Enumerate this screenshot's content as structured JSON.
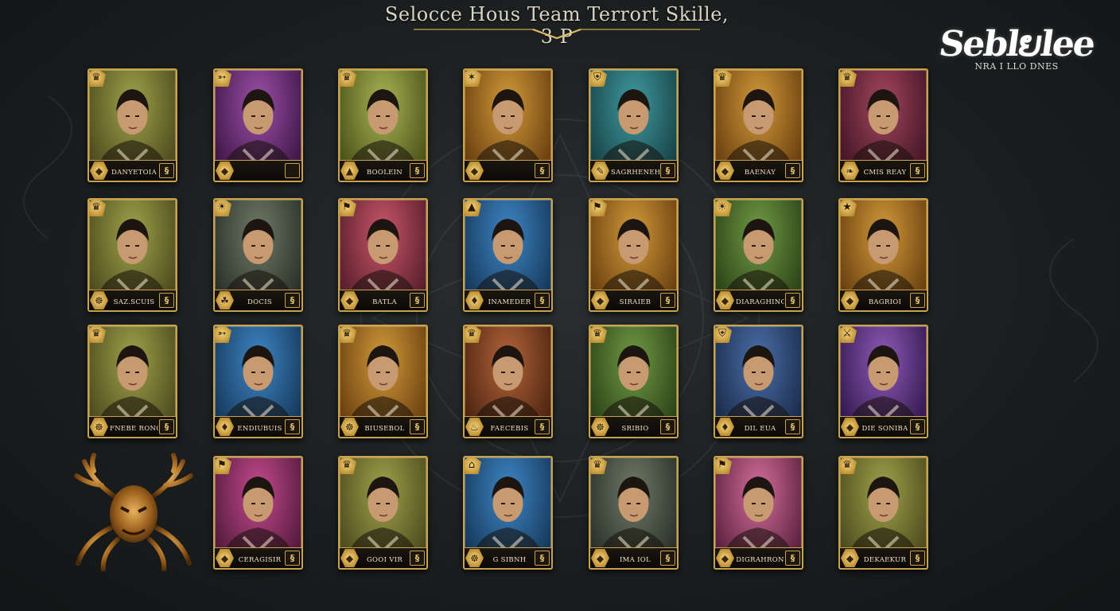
{
  "title": "Selocce Hous Team Terrort Skille, 3 P",
  "logo": {
    "mark": "Seblຍlee",
    "subtitle": "NRA I LLO DNES"
  },
  "colors": {
    "background": "#1c1f20",
    "gold": "#c8a24c",
    "text": "#efe3c2"
  },
  "emblem": {
    "icon": "antlered-demon-mask-icon"
  },
  "cards": [
    {
      "name": "DANYETOIA",
      "theme": "olive",
      "corner_icon": "crown-icon",
      "class_icon": "helm-icon",
      "skill_label": "§"
    },
    {
      "name": "",
      "theme": "purple",
      "corner_icon": "bow-icon",
      "class_icon": "helm-icon",
      "skill_label": ""
    },
    {
      "name": "BOOLEIN",
      "theme": "lime",
      "corner_icon": "crown-icon",
      "class_icon": "bell-icon",
      "skill_label": "§"
    },
    {
      "name": "",
      "theme": "amber",
      "corner_icon": "lantern-icon",
      "class_icon": "helm-icon",
      "skill_label": "§"
    },
    {
      "name": "SAGRHENEH",
      "theme": "teal",
      "corner_icon": "shield-icon",
      "class_icon": "quill-icon",
      "skill_label": "§"
    },
    {
      "name": "BAENAY",
      "theme": "amber",
      "corner_icon": "crown-icon",
      "class_icon": "helm-icon",
      "skill_label": "§"
    },
    {
      "name": "CMIS REAY",
      "theme": "maroon",
      "corner_icon": "crown-icon",
      "class_icon": "scroll-icon",
      "skill_label": "§"
    },
    {
      "name": "SAZ.SCUIS",
      "theme": "olive",
      "corner_icon": "crown-icon",
      "class_icon": "rune-icon",
      "skill_label": "§"
    },
    {
      "name": "DOCIS",
      "theme": "slate",
      "corner_icon": "sun-icon",
      "class_icon": "leaf-icon",
      "skill_label": "§"
    },
    {
      "name": "BATLA",
      "theme": "rose",
      "corner_icon": "flag-icon",
      "class_icon": "helm-icon",
      "skill_label": "§"
    },
    {
      "name": "INAMEDER",
      "theme": "blue",
      "corner_icon": "bell-icon",
      "class_icon": "gem-icon",
      "skill_label": "§"
    },
    {
      "name": "SIRAIEB",
      "theme": "amber",
      "corner_icon": "flag-icon",
      "class_icon": "helm-icon",
      "skill_label": "§"
    },
    {
      "name": "DIARAGHING",
      "theme": "green",
      "corner_icon": "sun-icon",
      "class_icon": "helm-icon",
      "skill_label": "§"
    },
    {
      "name": "BAGRIOI",
      "theme": "amber",
      "corner_icon": "star-icon",
      "class_icon": "helm-icon",
      "skill_label": "§"
    },
    {
      "name": "FNEBE RONO",
      "theme": "olive",
      "corner_icon": "crown-icon",
      "class_icon": "rune-icon",
      "skill_label": "§"
    },
    {
      "name": "ENDIUBUIS",
      "theme": "blue",
      "corner_icon": "bow-icon",
      "class_icon": "gem-icon",
      "skill_label": "§"
    },
    {
      "name": "BIUSEBOL",
      "theme": "amber",
      "corner_icon": "crown-icon",
      "class_icon": "rune-icon",
      "skill_label": "§"
    },
    {
      "name": "FAECEBIS",
      "theme": "rust",
      "corner_icon": "crown-icon",
      "class_icon": "flame-icon",
      "skill_label": "§"
    },
    {
      "name": "SRIBIO",
      "theme": "green",
      "corner_icon": "crown-icon",
      "class_icon": "rune-icon",
      "skill_label": "§"
    },
    {
      "name": "DIL EUA",
      "theme": "navy",
      "corner_icon": "shield-icon",
      "class_icon": "gem-icon",
      "skill_label": "§"
    },
    {
      "name": "DIE SONIBA",
      "theme": "violet",
      "corner_icon": "sword-icon",
      "class_icon": "helm-icon",
      "skill_label": "§"
    },
    {
      "name": "CERAGISIR",
      "theme": "magenta",
      "corner_icon": "flag-icon",
      "class_icon": "helm-icon",
      "skill_label": "§"
    },
    {
      "name": "GOOI VIR",
      "theme": "olive",
      "corner_icon": "crown-icon",
      "class_icon": "helm-icon",
      "skill_label": "§"
    },
    {
      "name": "G SIBNH",
      "theme": "blue",
      "corner_icon": "house-icon",
      "class_icon": "rune-icon",
      "skill_label": "§"
    },
    {
      "name": "IMA IOL",
      "theme": "slate",
      "corner_icon": "crown-icon",
      "class_icon": "helm-icon",
      "skill_label": "§"
    },
    {
      "name": "DIGRAHRON",
      "theme": "pink",
      "corner_icon": "flag-icon",
      "class_icon": "helm-icon",
      "skill_label": "§"
    },
    {
      "name": "DEKAEKUR",
      "theme": "olive",
      "corner_icon": "crown-icon",
      "class_icon": "helm-icon",
      "skill_label": "§"
    }
  ]
}
